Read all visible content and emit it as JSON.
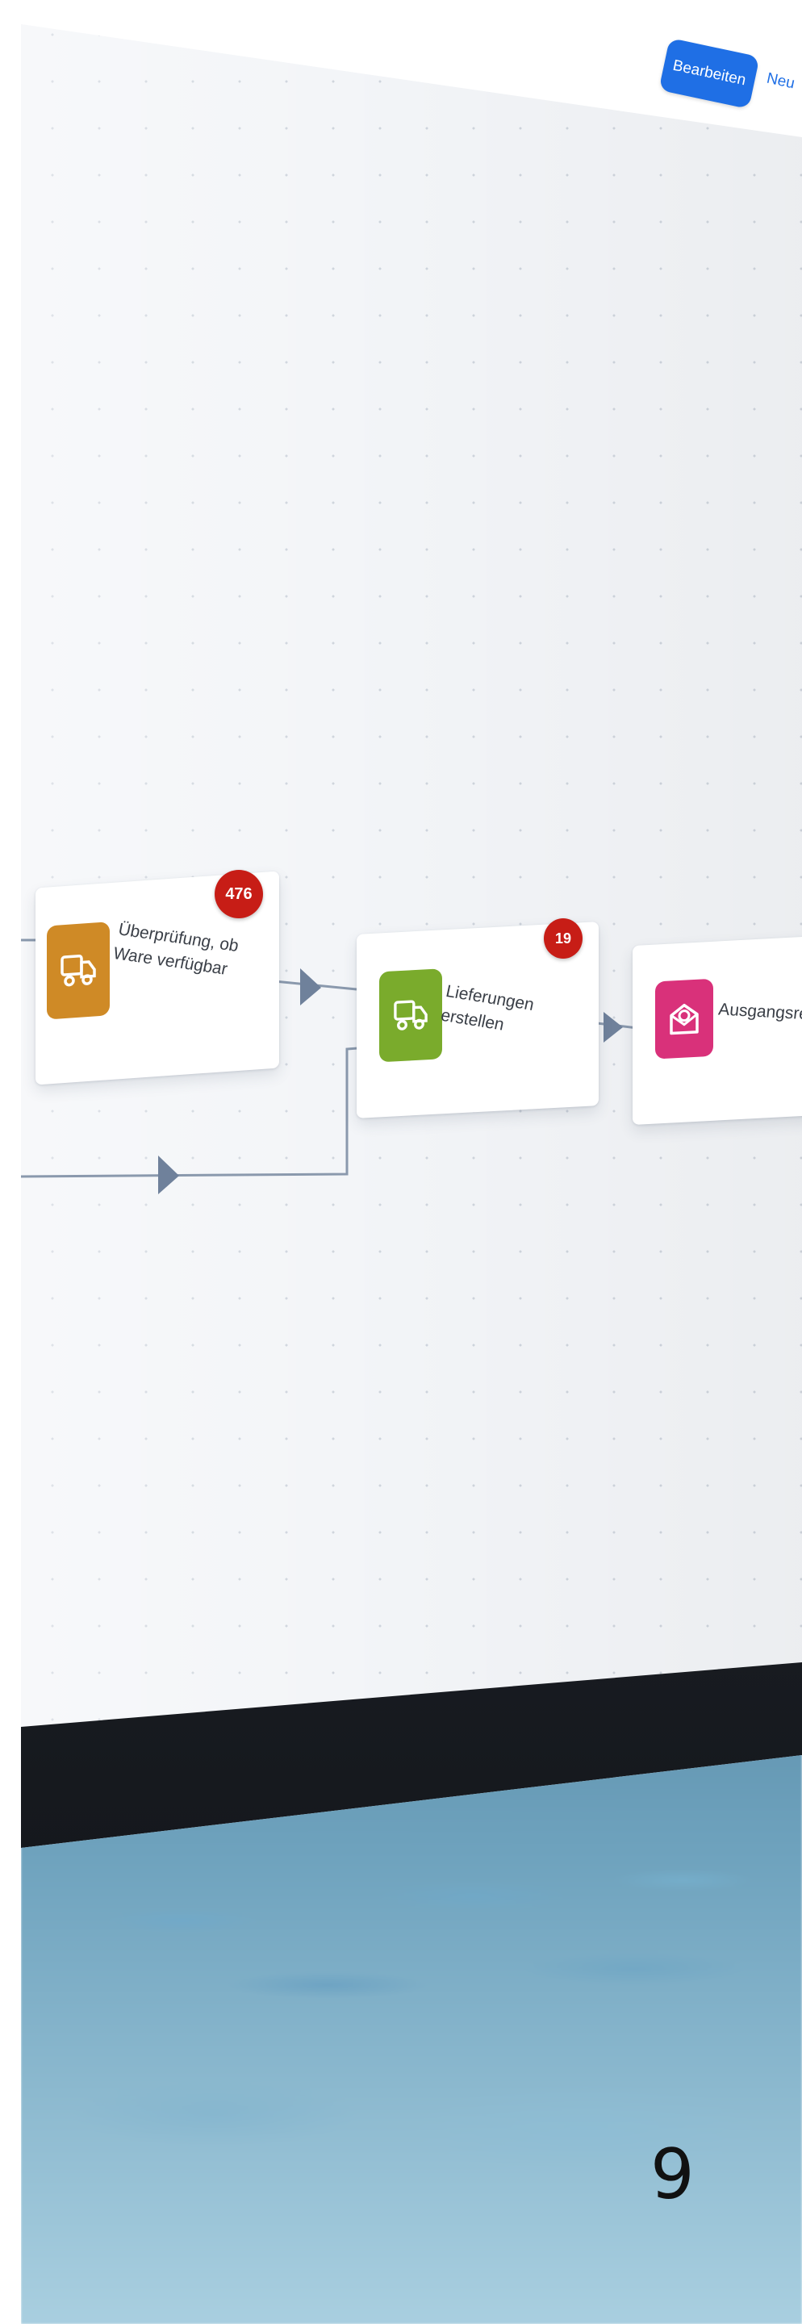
{
  "toolbar": {
    "edit_label": "Bearbeiten",
    "new_label": "Neu"
  },
  "process_steps": [
    {
      "label": "Überprüfung, ob Ware verfügbar",
      "badge_count": "476",
      "icon": "truck-icon",
      "color": "#cf8a26"
    },
    {
      "label": "Lieferungen erstellen",
      "badge_count": "19",
      "icon": "truck-icon",
      "color": "#7aab2c"
    },
    {
      "label": "Ausgangsrechnung erstellen",
      "badge_count": "",
      "icon": "invoice-icon",
      "color": "#d9317a"
    }
  ],
  "page_number": "9"
}
